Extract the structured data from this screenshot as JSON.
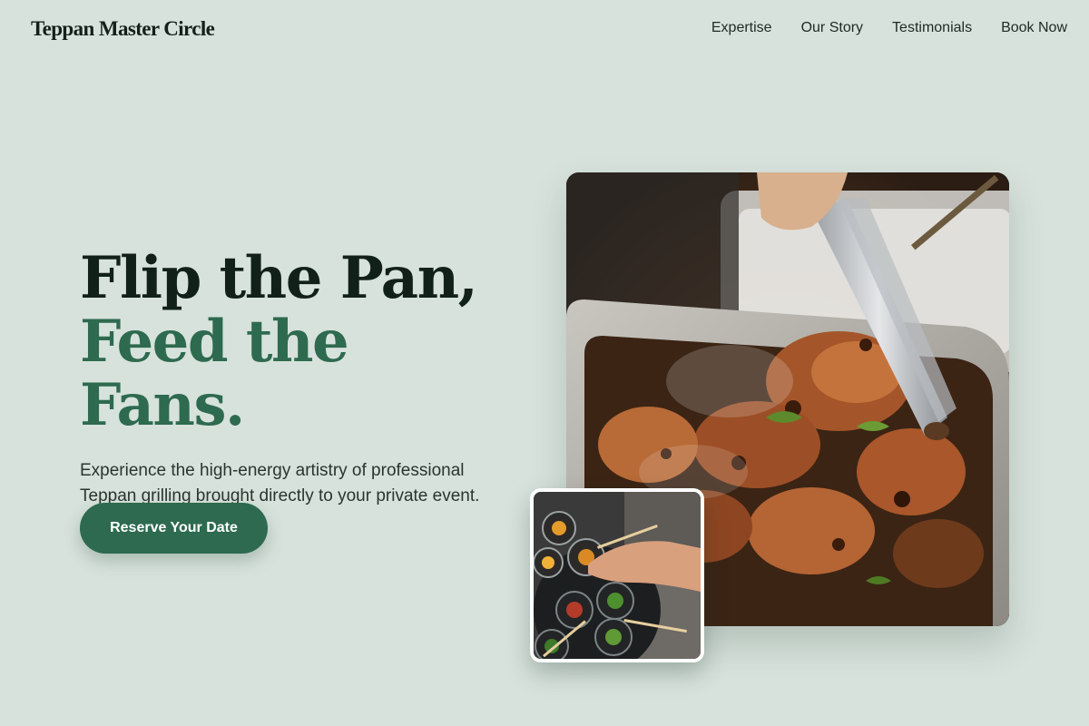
{
  "brand": {
    "name": "Teppan Master Circle"
  },
  "nav": {
    "items": [
      {
        "label": "Expertise"
      },
      {
        "label": "Our Story"
      },
      {
        "label": "Testimonials"
      },
      {
        "label": "Book Now"
      }
    ]
  },
  "hero": {
    "headline_line1": "Flip the Pan,",
    "headline_line2": "Feed the Fans.",
    "description": "Experience the high-energy artistry of professional Teppan grilling brought directly to your private event.",
    "cta_label": "Reserve Your Date"
  },
  "colors": {
    "background": "#d7e2dc",
    "accent": "#2d6a4f",
    "heading_dark": "#112119"
  }
}
